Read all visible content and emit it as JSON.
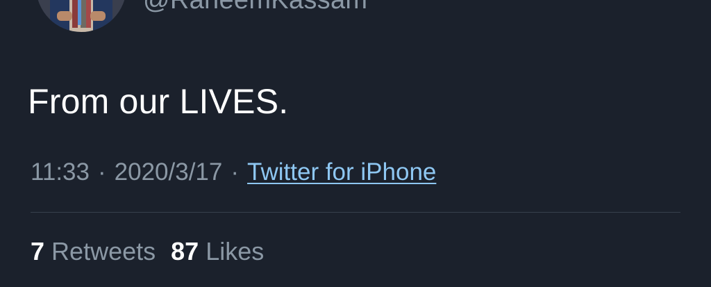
{
  "author": {
    "handle": "@RaheemKassam"
  },
  "tweet": {
    "text": "From our LIVES."
  },
  "meta": {
    "time": "11:33",
    "separator": "·",
    "date": "2020/3/17",
    "source": "Twitter for iPhone"
  },
  "stats": {
    "retweets_count": "7",
    "retweets_label": "Retweets",
    "likes_count": "87",
    "likes_label": "Likes"
  },
  "colors": {
    "background": "#1b212c",
    "primary_text": "#ffffff",
    "secondary_text": "#8b98a5",
    "link": "#8ec7f2",
    "divider": "#38404d"
  }
}
